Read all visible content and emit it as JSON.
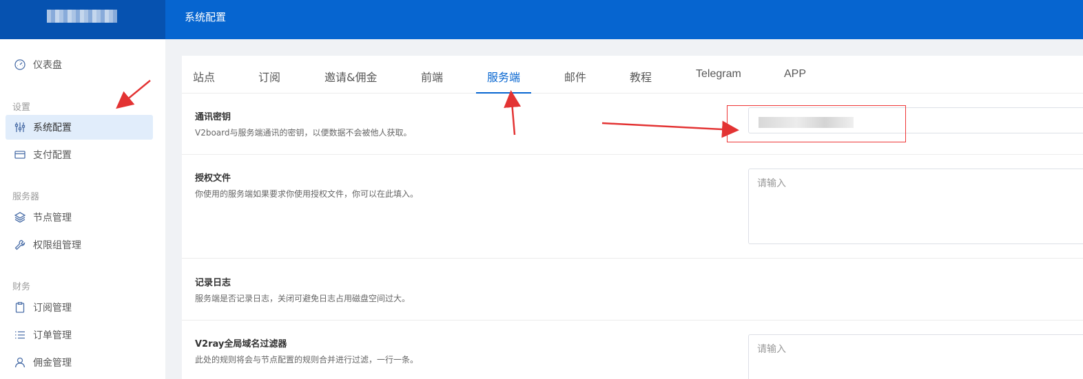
{
  "header": {
    "title": "系统配置"
  },
  "sidebar": {
    "dashboard": "仪表盘",
    "groups": {
      "settings": "设置",
      "server": "服务器",
      "finance": "财务"
    },
    "items": {
      "system_config": "系统配置",
      "payment_config": "支付配置",
      "node_manage": "节点管理",
      "permission_group": "权限组管理",
      "subscription_manage": "订阅管理",
      "order_manage": "订单管理",
      "commission_manage": "佣金管理"
    }
  },
  "tabs": [
    "站点",
    "订阅",
    "邀请&佣金",
    "前端",
    "服务端",
    "邮件",
    "教程",
    "Telegram",
    "APP"
  ],
  "active_tab": "服务端",
  "settings": {
    "comm_key": {
      "title": "通讯密钥",
      "desc": "V2board与服务端通讯的密钥，以便数据不会被他人获取。"
    },
    "auth_file": {
      "title": "授权文件",
      "desc": "你使用的服务端如果要求你使用授权文件，你可以在此填入。",
      "placeholder": "请输入"
    },
    "log": {
      "title": "记录日志",
      "desc": "服务端是否记录日志，关闭可避免日志占用磁盘空间过大。"
    },
    "v2ray_filter": {
      "title": "V2ray全局域名过滤器",
      "desc": "此处的规则将会与节点配置的规则合并进行过滤，一行一条。",
      "placeholder": "请输入"
    }
  },
  "colors": {
    "header": "#0665d0",
    "logo_bg": "#0652b0",
    "accent": "#0665d0",
    "annotation": "#e33333"
  }
}
